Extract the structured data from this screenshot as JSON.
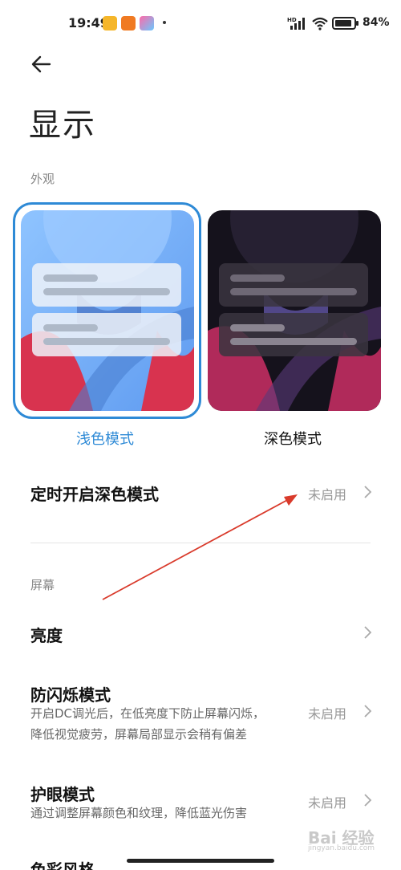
{
  "status_bar": {
    "time": "19:49",
    "battery": "84%",
    "network": "HD"
  },
  "page": {
    "title": "显示"
  },
  "appearance": {
    "section_label": "外观",
    "light_mode_label": "浅色模式",
    "dark_mode_label": "深色模式",
    "selected": "light",
    "accent_color": "#2e8ad6"
  },
  "dark_schedule": {
    "label": "定时开启深色模式",
    "value": "未启用"
  },
  "screen": {
    "section_label": "屏幕",
    "brightness_label": "亮度",
    "anti_flicker": {
      "label": "防闪烁模式",
      "desc_line1": "开启DC调光后，在低亮度下防止屏幕闪烁，",
      "desc_line2": "降低视觉疲劳，屏幕局部显示会稍有偏差",
      "value": "未启用"
    },
    "eye_care": {
      "label": "护眼模式",
      "desc": "通过调整屏幕颜色和纹理，降低蓝光伤害",
      "value": "未启用"
    },
    "color_style_label": "色彩风格"
  },
  "watermark": {
    "text": "Bai 经验",
    "sub": "jingyan.baidu.com"
  },
  "annotation": {
    "arrow_color": "#d93a2b"
  }
}
